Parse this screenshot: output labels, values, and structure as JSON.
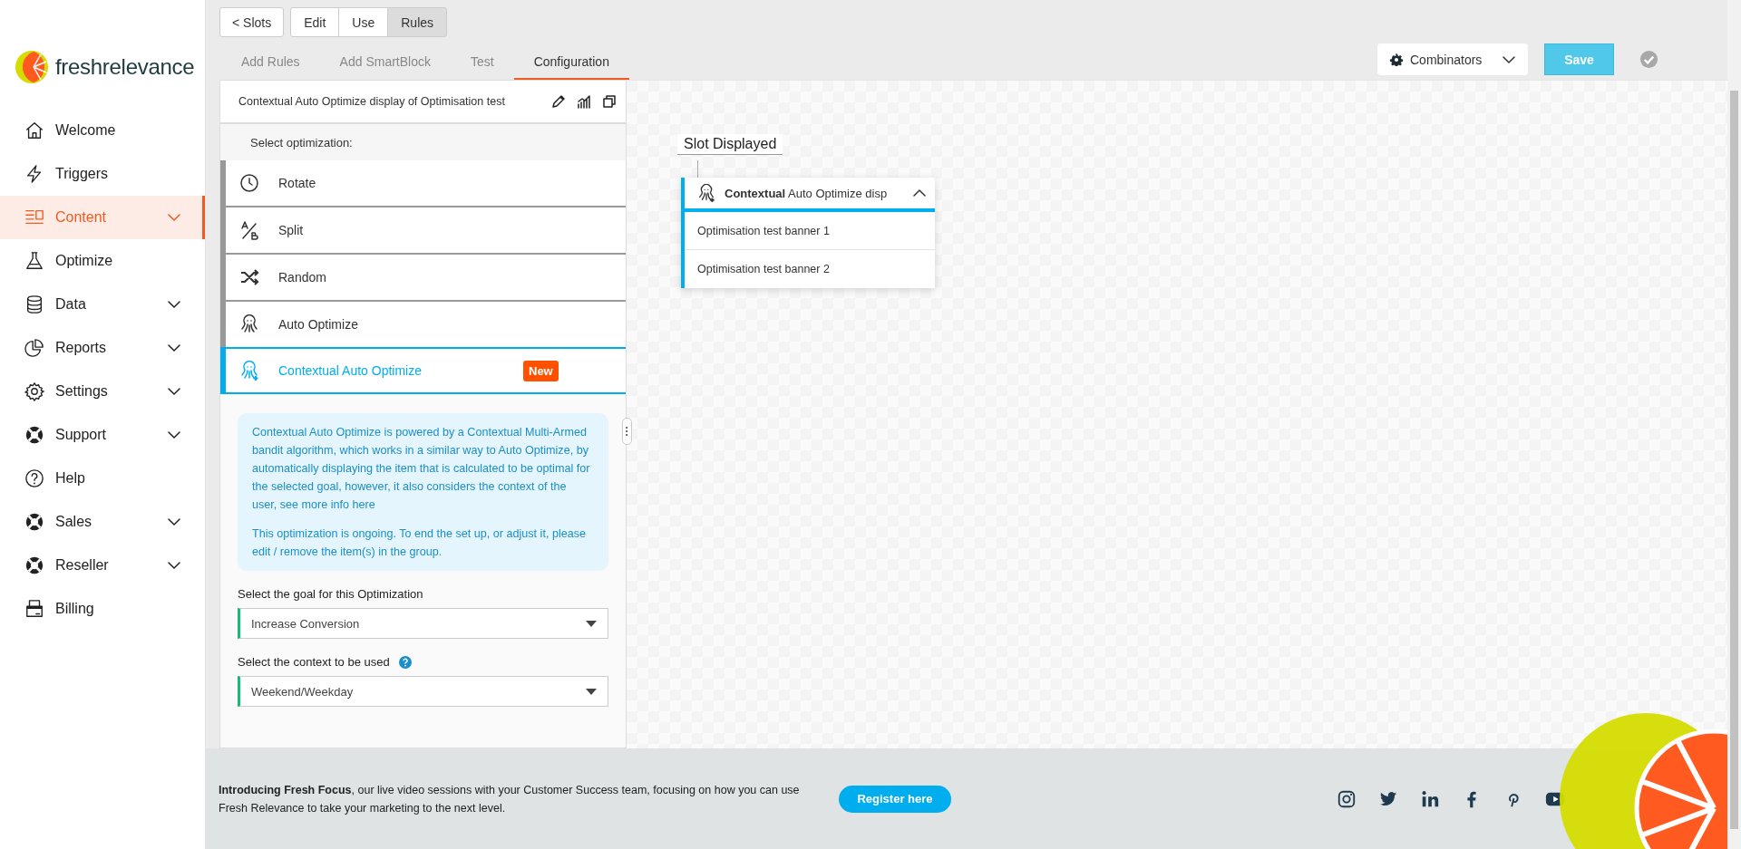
{
  "logo": {
    "text": "freshrelevance"
  },
  "sidebar": {
    "items": [
      {
        "label": "Welcome",
        "selected": false,
        "expandable": false
      },
      {
        "label": "Triggers",
        "selected": false,
        "expandable": false
      },
      {
        "label": "Content",
        "selected": true,
        "expandable": true
      },
      {
        "label": "Optimize",
        "selected": false,
        "expandable": false
      },
      {
        "label": "Data",
        "selected": false,
        "expandable": true
      },
      {
        "label": "Reports",
        "selected": false,
        "expandable": true
      },
      {
        "label": "Settings",
        "selected": false,
        "expandable": true
      },
      {
        "label": "Support",
        "selected": false,
        "expandable": true
      },
      {
        "label": "Help",
        "selected": false,
        "expandable": false
      },
      {
        "label": "Sales",
        "selected": false,
        "expandable": true
      },
      {
        "label": "Reseller",
        "selected": false,
        "expandable": true
      },
      {
        "label": "Billing",
        "selected": false,
        "expandable": false
      }
    ]
  },
  "toolbar": {
    "back_button": "< Slots",
    "mode_buttons": [
      {
        "label": "Edit",
        "selected": false
      },
      {
        "label": "Use",
        "selected": false
      },
      {
        "label": "Rules",
        "selected": true
      }
    ]
  },
  "tabs": [
    {
      "label": "Add Rules",
      "selected": false
    },
    {
      "label": "Add SmartBlock",
      "selected": false
    },
    {
      "label": "Test",
      "selected": false
    },
    {
      "label": "Configuration",
      "selected": true
    }
  ],
  "combinators": {
    "label": "Combinators"
  },
  "save_button": "Save",
  "panel": {
    "title": "Contextual Auto Optimize display of Optimisation test",
    "section_label": "Select optimization:",
    "options": [
      {
        "label": "Rotate",
        "selected": false
      },
      {
        "label": "Split",
        "selected": false
      },
      {
        "label": "Random",
        "selected": false
      },
      {
        "label": "Auto Optimize",
        "selected": false
      },
      {
        "label": "Contextual Auto Optimize",
        "selected": true,
        "badge": "New"
      }
    ],
    "info": [
      "Contextual Auto Optimize is powered by a Contextual Multi-Armed bandit algorithm, which works in a similar way to Auto Optimize, by automatically displaying the item that is calculated to be optimal for the selected goal, however, it also considers the context of the user, see more info here",
      "This optimization is ongoing. To end the set up, or adjust it, please edit / remove the item(s) in the group."
    ],
    "goal_label": "Select the goal for this Optimization",
    "goal_value": "Increase Conversion",
    "context_label": "Select the context to be used",
    "context_value": "Weekend/Weekday"
  },
  "canvas": {
    "slot_label": "Slot Displayed",
    "node": {
      "title": "**Contextual** Auto Optimize disp",
      "expanded": true,
      "items": [
        "Optimisation test banner 1",
        "Optimisation test banner 2"
      ]
    }
  },
  "footer": {
    "text": "**Introducing Fresh Focus**, our live video sessions with your Customer Success team, focusing on how you can use Fresh Relevance to take your marketing to the next level.",
    "button": "Register here"
  }
}
